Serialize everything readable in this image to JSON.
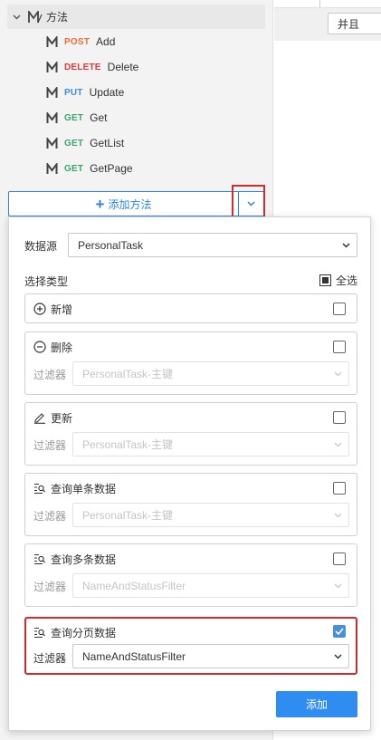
{
  "tree": {
    "group_title": "方法",
    "items": [
      {
        "verb": "POST",
        "name": "Add",
        "color": "#f26b3a"
      },
      {
        "verb": "DELETE",
        "name": "Delete",
        "color": "#e5383b"
      },
      {
        "verb": "PUT",
        "name": "Update",
        "color": "#3d8be0"
      },
      {
        "verb": "GET",
        "name": "Get",
        "color": "#3aa869"
      },
      {
        "verb": "GET",
        "name": "GetList",
        "color": "#3aa869"
      },
      {
        "verb": "GET",
        "name": "GetPage",
        "color": "#3aa869"
      }
    ],
    "add_method_label": "添加方法"
  },
  "right": {
    "logic_select": "并且"
  },
  "popup": {
    "datasource_label": "数据源",
    "datasource_value": "PersonalTask",
    "type_label": "选择类型",
    "select_all_label": "全选",
    "filter_label": "过滤器",
    "cards": [
      {
        "name": "新增",
        "icon": "plus-circle-icon",
        "checked": false,
        "has_filter": false
      },
      {
        "name": "删除",
        "icon": "minus-circle-icon",
        "checked": false,
        "has_filter": true,
        "filter_value": "PersonalTask-主键"
      },
      {
        "name": "更新",
        "icon": "edit-icon",
        "checked": false,
        "has_filter": true,
        "filter_value": "PersonalTask-主键"
      },
      {
        "name": "查询单条数据",
        "icon": "query-icon",
        "checked": false,
        "has_filter": true,
        "filter_value": "PersonalTask-主键"
      },
      {
        "name": "查询多条数据",
        "icon": "query-icon",
        "checked": false,
        "has_filter": true,
        "filter_value": "NameAndStatusFilter"
      },
      {
        "name": "查询分页数据",
        "icon": "query-icon",
        "checked": true,
        "has_filter": true,
        "filter_value": "NameAndStatusFilter"
      }
    ],
    "submit_label": "添加"
  },
  "colors": {
    "accent": "#2f8cf0",
    "highlight": "#d62a2a"
  }
}
